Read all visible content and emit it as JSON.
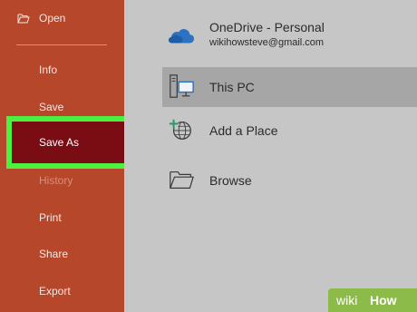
{
  "sidebar": {
    "open_label": "Open",
    "items": [
      {
        "label": "Info"
      },
      {
        "label": "Save"
      },
      {
        "label": "Save As"
      },
      {
        "label": "History"
      },
      {
        "label": "Print"
      },
      {
        "label": "Share"
      },
      {
        "label": "Export"
      }
    ]
  },
  "locations": [
    {
      "title": "OneDrive - Personal",
      "subtitle": "wikihowsteve@gmail.com",
      "icon": "cloud-icon"
    },
    {
      "title": "This PC",
      "icon": "computer-icon"
    },
    {
      "title": "Add a Place",
      "icon": "add-globe-icon"
    },
    {
      "title": "Browse",
      "icon": "folder-icon"
    }
  ],
  "watermark": {
    "part1": "wiki",
    "part2": "How"
  },
  "colors": {
    "sidebar": "#b7472a",
    "selected": "#7a0c13",
    "highlight_border": "#4cf03e",
    "main_background": "#c6c6c6",
    "active_row": "#a6a6a6",
    "watermark": "#8dbb49"
  }
}
